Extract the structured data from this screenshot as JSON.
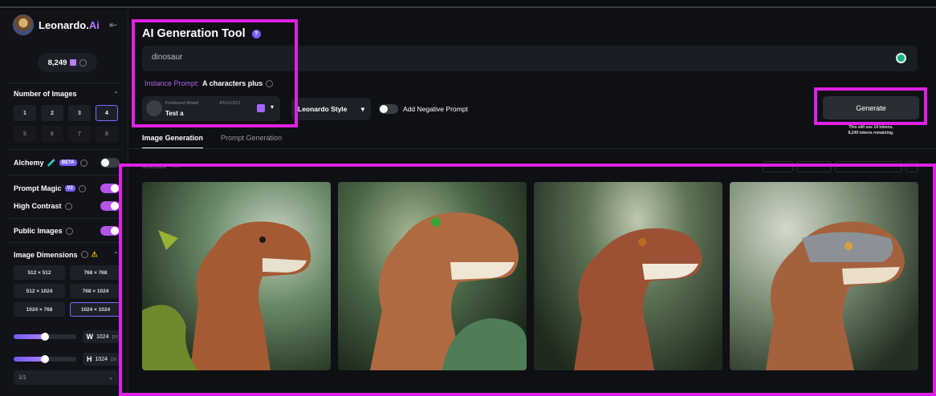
{
  "app": {
    "brand": "Leonardo.",
    "brand_accent": "Ai",
    "token_count": "8,249"
  },
  "sidebar": {
    "num_images_title": "Number of Images",
    "num_images": [
      "1",
      "2",
      "3",
      "4",
      "5",
      "6",
      "7",
      "8"
    ],
    "num_images_selected": "4",
    "alchemy_label": "Alchemy",
    "alchemy_badge": "BETA",
    "alchemy_on": false,
    "prompt_magic_label": "Prompt Magic",
    "prompt_magic_badge": "V2",
    "prompt_magic_on": true,
    "high_contrast_label": "High Contrast",
    "high_contrast_on": true,
    "public_images_label": "Public Images",
    "public_images_on": true,
    "image_dimensions_title": "Image Dimensions",
    "dimensions": [
      "512 × 512",
      "768 × 768",
      "512 × 1024",
      "768 × 1024",
      "1024 × 768",
      "1024 × 1024"
    ],
    "dimension_selected": "1024 × 1024",
    "width_label": "W",
    "width_value": "1024",
    "height_label": "H",
    "height_value": "1024",
    "unit": "px",
    "aspect_ratio": "1/1"
  },
  "main": {
    "title": "AI Generation Tool",
    "prompt_value": "dinosaur",
    "instance_prompt_key": "Instance Prompt:",
    "instance_prompt_value": "A characters plus",
    "model_caption": "Finetuned Model",
    "model_size": "512×512",
    "model_name": "Test a",
    "style": "Leonardo Style",
    "negative_prompt_label": "Add Negative Prompt",
    "generate_label": "Generate",
    "generate_note_1": "This will use 14 tokens.",
    "generate_note_2": "8,249 tokens remaining.",
    "tabs": [
      "Image Generation",
      "Prompt Generation"
    ],
    "gallery_prompt": "dinosaur"
  },
  "colors": {
    "highlight": "#e020e6",
    "accent": "#b455e8"
  }
}
